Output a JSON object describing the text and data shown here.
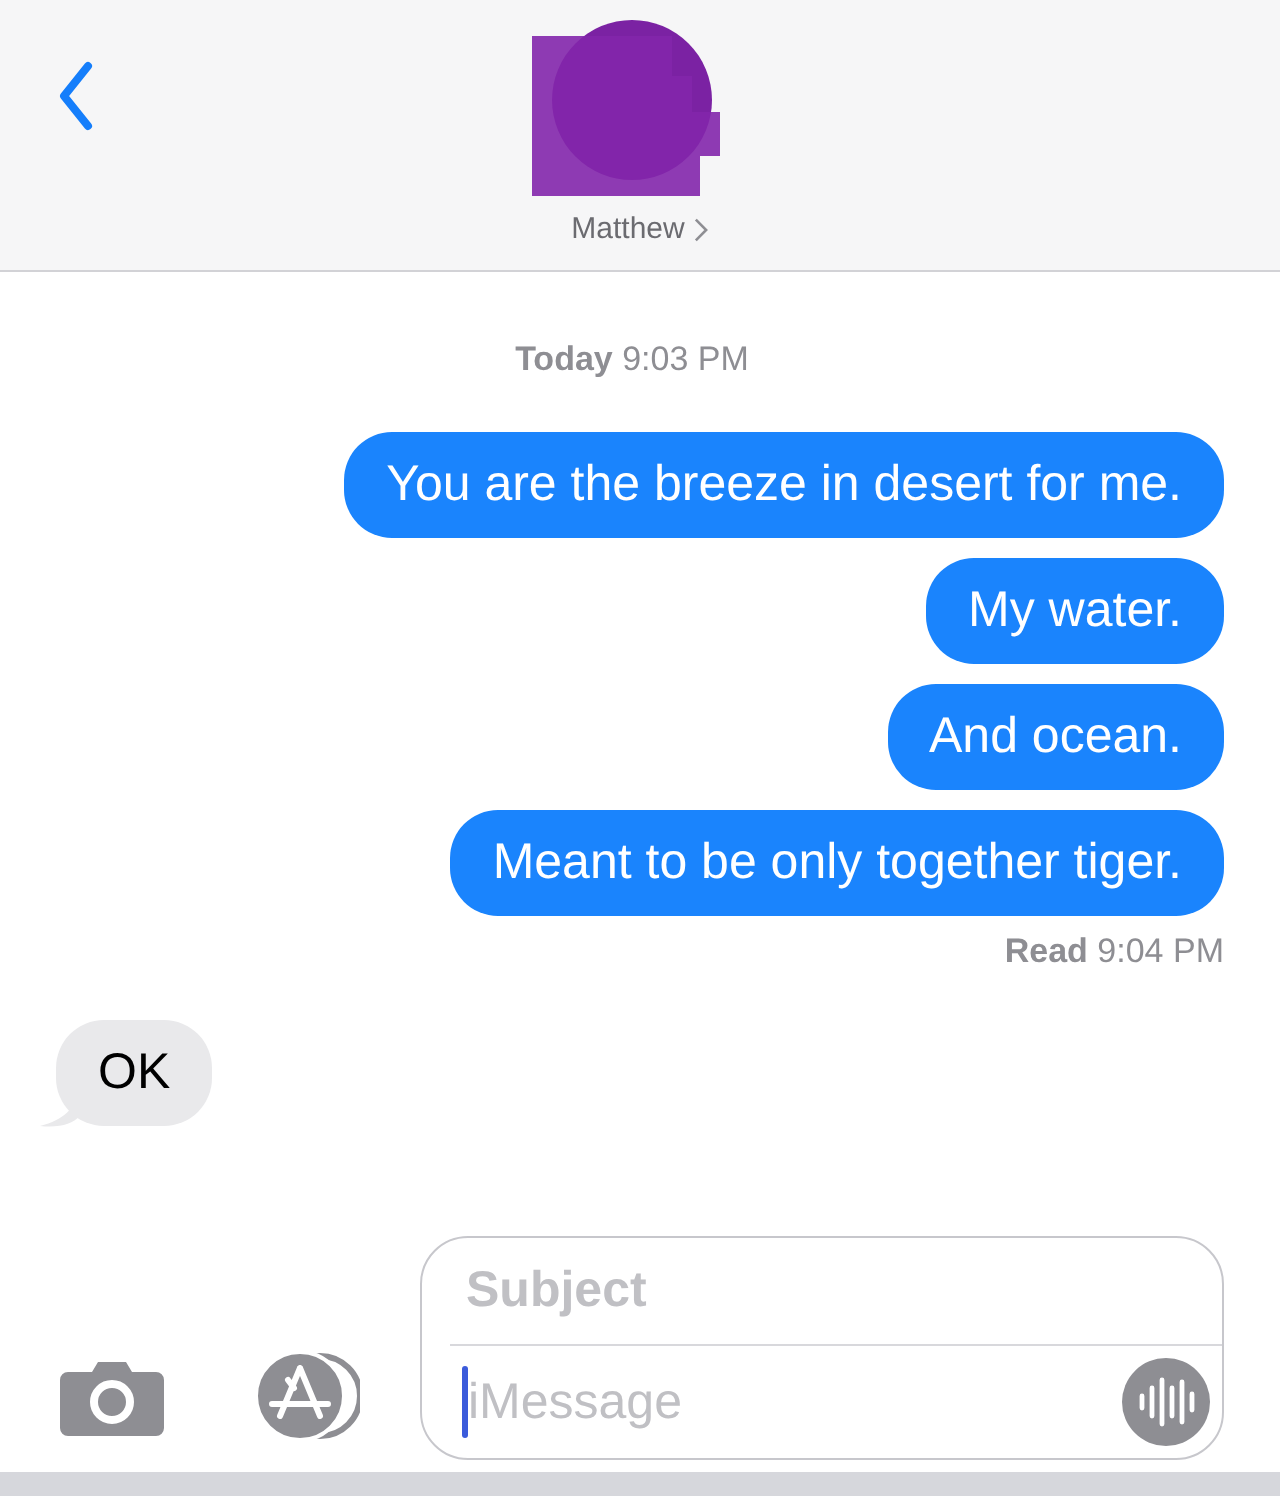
{
  "header": {
    "contact_name": "Matthew",
    "redacted": true
  },
  "conversation": [
    {
      "kind": "timestamp",
      "text": "**Today** 9:03 PM"
    },
    {
      "kind": "sent",
      "text": "You are the breeze in desert for me."
    },
    {
      "kind": "sent",
      "text": "My water."
    },
    {
      "kind": "sent",
      "text": "And ocean."
    },
    {
      "kind": "sent",
      "text": "Meant to be only together tiger."
    },
    {
      "kind": "receipt",
      "text": "**Read** 9:04 PM"
    },
    {
      "kind": "received",
      "text": "OK"
    }
  ],
  "composer": {
    "subject": {
      "placeholder": "Subject"
    },
    "message": {
      "placeholder": "iMessage"
    }
  }
}
